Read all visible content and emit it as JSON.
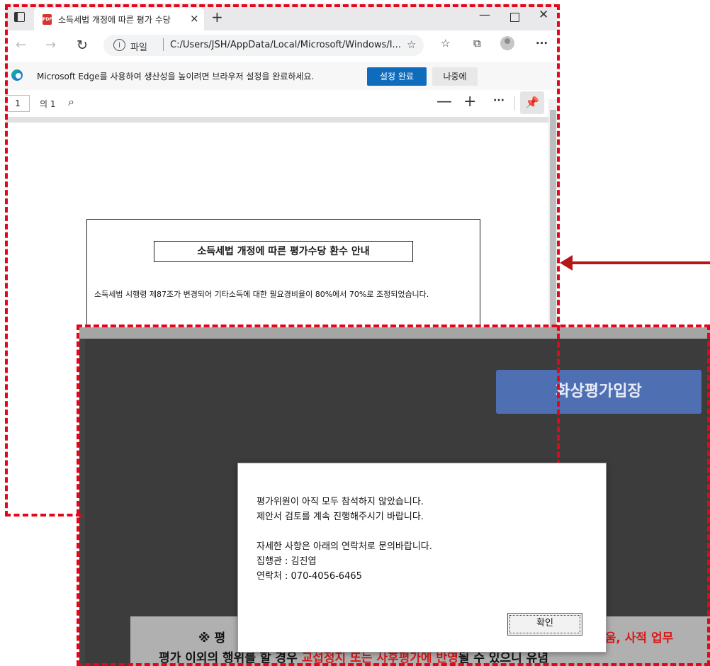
{
  "browser": {
    "tab_title": "소득세법 개정에 따른 평가 수당",
    "tab_close": "×",
    "new_tab": "+",
    "win_min": "—",
    "win_close": "✕",
    "address": {
      "origin_label": "파일",
      "path": "C:/Users/JSH/AppData/Local/Microsoft/Windows/I..."
    },
    "toolbar_icons": [
      "back-icon",
      "forward-icon",
      "refresh-icon",
      "favorite-add-icon",
      "favorites-icon",
      "collections-icon",
      "profile-icon",
      "more-icon"
    ],
    "more_label": "···",
    "infobar": {
      "message": "Microsoft Edge를 사용하여 생산성을 높이려면 브라우저 설정을 완료하세요.",
      "primary_button": "설정 완료",
      "secondary_button": "나중에"
    },
    "pdf_toolbar": {
      "page": "1",
      "page_total": "의 1",
      "zoom_out": "—",
      "zoom_in": "+",
      "more": "···"
    },
    "document": {
      "title": "소득세법 개정에 따른 평가수당 환수 안내",
      "body": "소득세법 시행령 제87조가 변경되어 기타소득에 대한 필요경비율이 80%에서 70%로 조정되었습니다."
    }
  },
  "eval_screen": {
    "enter_button": "화상평가입장",
    "notice_line1_start": "※ 평",
    "notice_line1_red": "비움, 사적 업무",
    "notice_line2_start": "평가 이외의 행위를 할 경우",
    "notice_line2_red": "교섭정지 또는 사후평가에 반영",
    "notice_line2_end": "될 수 있으니 유념"
  },
  "dialog": {
    "lines": [
      "평가위원이 아직 모두 참석하지 않았습니다.",
      "제안서 검토를 계속 진행해주시기 바랍니다.",
      "",
      "자세한 사항은 아래의 연락처로 문의바랍니다.",
      "집행관 : 김진엽",
      "연락처 : 070-4056-6465"
    ],
    "ok_button": "확인"
  },
  "colors": {
    "frame_red": "#e4071c",
    "arrow_red": "#b51717",
    "edge_blue": "#0f6cbd",
    "enter_button_blue": "#4f6fb3",
    "notice_red": "#d81818"
  }
}
